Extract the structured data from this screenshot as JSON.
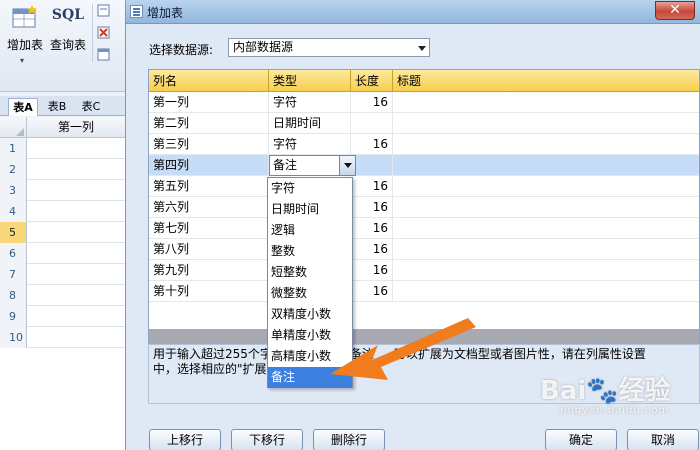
{
  "ribbon": {
    "add_table_label": "增加表",
    "sql_label": "SQL",
    "query_table_label": "查询表",
    "dropdown_caret": "▾"
  },
  "sheet_tabs": [
    "表A",
    "表B",
    "表C"
  ],
  "grid": {
    "column_header": "第一列",
    "row_numbers": [
      "1",
      "2",
      "3",
      "4",
      "5",
      "6",
      "7",
      "8",
      "9",
      "10"
    ],
    "selected_row": "5"
  },
  "dialog": {
    "title": "增加表",
    "close_label": "✕",
    "source_label": "选择数据源:",
    "source_value": "内部数据源",
    "columns_header": [
      "列名",
      "类型",
      "长度",
      "标题"
    ],
    "rows": [
      {
        "name": "第一列",
        "type": "字符",
        "length": "16",
        "caption": ""
      },
      {
        "name": "第二列",
        "type": "日期时间",
        "length": "",
        "caption": ""
      },
      {
        "name": "第三列",
        "type": "字符",
        "length": "16",
        "caption": ""
      },
      {
        "name": "第四列",
        "type": "备注",
        "length": "",
        "caption": ""
      },
      {
        "name": "第五列",
        "type": "",
        "length": "16",
        "caption": ""
      },
      {
        "name": "第六列",
        "type": "",
        "length": "16",
        "caption": ""
      },
      {
        "name": "第七列",
        "type": "",
        "length": "16",
        "caption": ""
      },
      {
        "name": "第八列",
        "type": "",
        "length": "16",
        "caption": ""
      },
      {
        "name": "第九列",
        "type": "",
        "length": "16",
        "caption": ""
      },
      {
        "name": "第十列",
        "type": "",
        "length": "16",
        "caption": ""
      }
    ],
    "selected_row_index": 3,
    "type_options": [
      "字符",
      "日期时间",
      "逻辑",
      "整数",
      "短整数",
      "微整数",
      "双精度小数",
      "单精度小数",
      "高精度小数",
      "备注"
    ],
    "highlighted_option": "备注",
    "description_line1": "用于输入超过255个字",
    "description_line1_tail": "备注",
    "description_line1_tail2": "可以扩展为文档型或者图片性，请在列属性设置",
    "description_line2": "中，选择相应的\"扩展",
    "buttons": {
      "move_up": "上移行",
      "move_down": "下移行",
      "delete_row": "删除行",
      "ok": "确定",
      "cancel": "取消"
    }
  },
  "colors": {
    "header_gold": "#f7cf4d",
    "selection_blue": "#c7dcf7",
    "highlight_blue": "#3d80df",
    "arrow_orange": "#f07c1e"
  },
  "watermark": {
    "text": "Bai",
    "text2": "经验",
    "domain": "jingyan.baidu.com"
  }
}
